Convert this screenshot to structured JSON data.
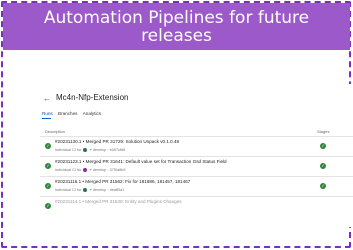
{
  "slide": {
    "title": "Automation Pipelines for future releases"
  },
  "pipeline": {
    "name": "Mc4n-Nfp-Extension",
    "back_icon": "arrow-left-icon",
    "tabs": [
      {
        "label": "Runs",
        "active": true
      },
      {
        "label": "Branches",
        "active": false
      },
      {
        "label": "Analytics",
        "active": false
      }
    ],
    "columns": {
      "description": "Description",
      "stages": "Stages"
    },
    "runs": [
      {
        "title": "#20231130.1 • Merged PR 31729: Solution Unpack v0.1.0.48",
        "trigger": "Individual CI for",
        "branch": "develop",
        "commit": "b097cf68",
        "status": "succeeded"
      },
      {
        "title": "#20231123.1 • Merged PR 31641: Default value set for Transaction Gsd Status Field",
        "trigger": "Individual CI for",
        "branch": "develop",
        "commit": "37f0a8b9",
        "status": "succeeded"
      },
      {
        "title": "#20231116.1 • Merged PR 31562: Fix for 181886, 181457, 181467",
        "trigger": "Individual CI for",
        "branch": "develop",
        "commit": "deaff0a1",
        "status": "succeeded"
      },
      {
        "title": "#20231114.1 • Merged PR 31520: Entity and Plugins Changes",
        "trigger": "",
        "branch": "",
        "commit": "",
        "status": "succeeded"
      }
    ],
    "status_color": "#2e8a3a"
  }
}
